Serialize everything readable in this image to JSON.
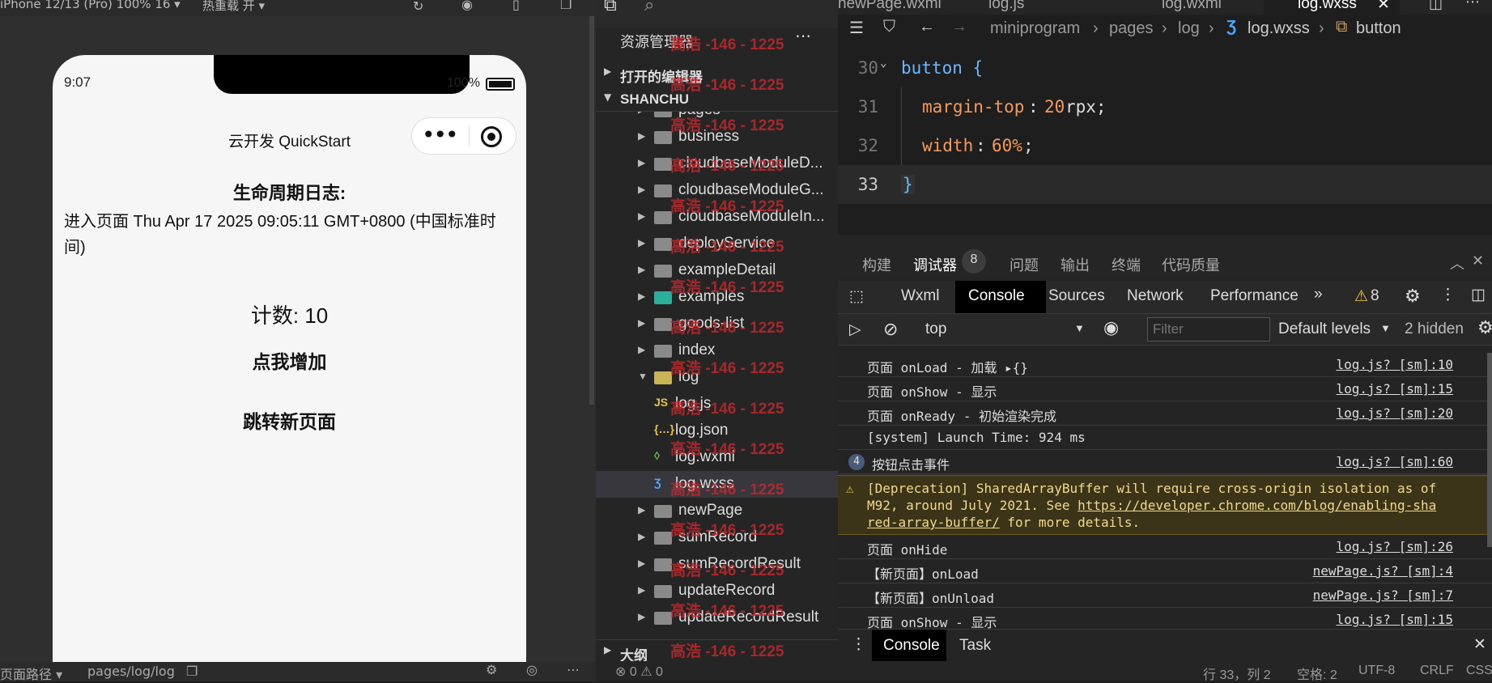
{
  "simulator": {
    "device_label": "iPhone 12/13 (Pro) 100% 16 ▾",
    "hot_reload": "热重载 开 ▾",
    "status_time": "9:07",
    "battery": "100%",
    "nav_title": "云开发 QuickStart",
    "lifecycle_title": "生命周期日志:",
    "lifecycle_text": "进入页面 Thu Apr 17 2025 09:05:11 GMT+0800 (中国标准时间)",
    "counter_text": "计数: 10",
    "increase_button": "点我增加",
    "navigate_button": "跳转新页面",
    "page_path_label": "页面路径 ▾",
    "page_path_value": "pages/log/log"
  },
  "explorer": {
    "title": "资源管理器",
    "open_editors": "打开的编辑器",
    "project": "SHANCHU",
    "outline": "大纲",
    "items": [
      {
        "label": "pages",
        "type": "folder-partial"
      },
      {
        "label": "business",
        "type": "folder"
      },
      {
        "label": "cloudbaseModuleD...",
        "type": "folder"
      },
      {
        "label": "cloudbaseModuleG...",
        "type": "folder"
      },
      {
        "label": "cloudbaseModuleIn...",
        "type": "folder"
      },
      {
        "label": "deployService",
        "type": "folder"
      },
      {
        "label": "exampleDetail",
        "type": "folder"
      },
      {
        "label": "examples",
        "type": "folder-special"
      },
      {
        "label": "goods-list",
        "type": "folder"
      },
      {
        "label": "index",
        "type": "folder"
      },
      {
        "label": "log",
        "type": "folder-open"
      },
      {
        "label": "log.js",
        "type": "js"
      },
      {
        "label": "log.json",
        "type": "json"
      },
      {
        "label": "log.wxml",
        "type": "wxml"
      },
      {
        "label": "log.wxss",
        "type": "wxss"
      },
      {
        "label": "newPage",
        "type": "folder"
      },
      {
        "label": "sumRecord",
        "type": "folder"
      },
      {
        "label": "sumRecordResult",
        "type": "folder"
      },
      {
        "label": "updateRecord",
        "type": "folder"
      },
      {
        "label": "updateRecordResult",
        "type": "folder"
      }
    ],
    "watermark": "高浩 -146 - 1225"
  },
  "editor": {
    "tabs": [
      "newPage.wxml",
      "log.js",
      "log.wxml",
      "log.wxss"
    ],
    "breadcrumb": [
      "miniprogram",
      "pages",
      "log",
      "log.wxss",
      "button"
    ],
    "lines": [
      {
        "num": "30",
        "text": "button {"
      },
      {
        "num": "31",
        "prop": "margin-top",
        "value": "20",
        "unit": "rpx;"
      },
      {
        "num": "32",
        "prop": "width",
        "value": "60%",
        "unit": ";"
      },
      {
        "num": "33",
        "text": "}"
      }
    ]
  },
  "debugger": {
    "top_tabs": [
      "构建",
      "调试器",
      "问题",
      "输出",
      "终端",
      "代码质量"
    ],
    "debugger_badge": "8",
    "devtools_tabs": [
      "Wxml",
      "Console",
      "Sources",
      "Network",
      "Performance"
    ],
    "warning_count": "8",
    "context": "top",
    "filter_placeholder": "Filter",
    "levels": "Default levels",
    "hidden": "2 hidden",
    "logs": [
      {
        "msg": "页面 onLoad - 加载 ▸{}",
        "src": "log.js? [sm]:10"
      },
      {
        "msg": "页面 onShow - 显示",
        "src": "log.js? [sm]:15"
      },
      {
        "msg": "页面 onReady - 初始渲染完成",
        "src": "log.js? [sm]:20"
      },
      {
        "msg": "[system] Launch Time: 924 ms",
        "src": ""
      },
      {
        "msg": "按钮点击事件",
        "src": "log.js? [sm]:60",
        "count": "4"
      }
    ],
    "warning": {
      "line1": "[Deprecation] SharedArrayBuffer will require cross-origin isolation as of",
      "line2a": "M92, around July 2021. See ",
      "link1": "https://developer.chrome.com/blog/enabling-sha",
      "link2": "red-array-buffer/",
      "line3b": " for more details."
    },
    "logs2": [
      {
        "msg": "页面 onHide",
        "src": "log.js? [sm]:26"
      },
      {
        "msg": "【新页面】onLoad",
        "src": "newPage.js? [sm]:4"
      },
      {
        "msg": "【新页面】onUnload",
        "src": "newPage.js? [sm]:7"
      },
      {
        "msg": "页面 onShow - 显示",
        "src": "log.js? [sm]:15"
      }
    ],
    "drawer_tabs": [
      "Console",
      "Task"
    ]
  },
  "statusbar": {
    "errors": "⊗ 0 ⚠ 0",
    "position": "行 33，列 2",
    "spaces": "空格: 2",
    "encoding": "UTF-8",
    "eol": "CRLF",
    "lang": "CSS"
  }
}
